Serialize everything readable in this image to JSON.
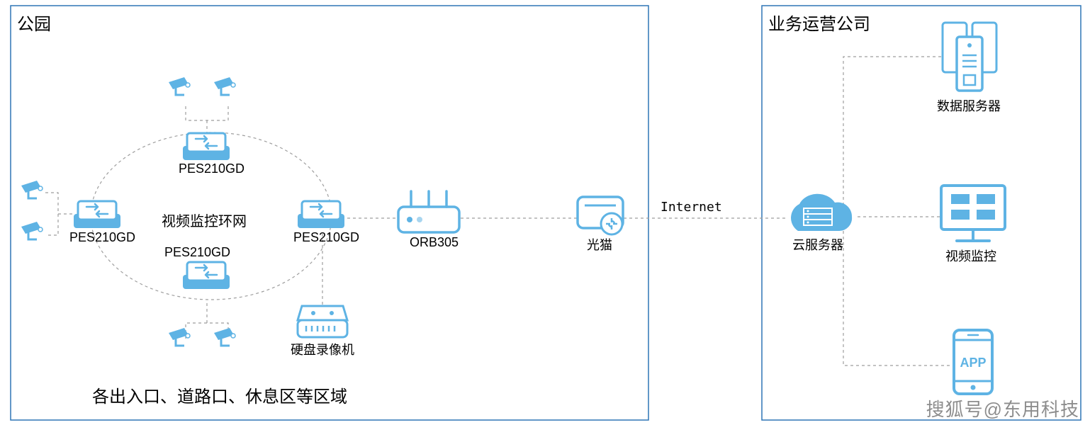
{
  "colors": {
    "border": "#2e75b6",
    "line": "#9e9e9e",
    "icon": "#5eb3e4",
    "iconLight": "#a8d5ef"
  },
  "leftBox": {
    "title": "公园"
  },
  "rightBox": {
    "title": "业务运营公司"
  },
  "nodes": {
    "switchTop": "PES210GD",
    "switchLeft": "PES210GD",
    "switchBottom": "PES210GD",
    "switchRight": "PES210GD",
    "ringCenter": "视频监控环网",
    "router": "ORB305",
    "modem": "光猫",
    "nvr": "硬盘录像机",
    "cloud": "云服务器",
    "servers": "数据服务器",
    "monitor": "视频监控",
    "app": "APP",
    "linkLabel": "Internet"
  },
  "caption": "各出入口、道路口、休息区等区域",
  "watermark": "搜狐号@东用科技"
}
